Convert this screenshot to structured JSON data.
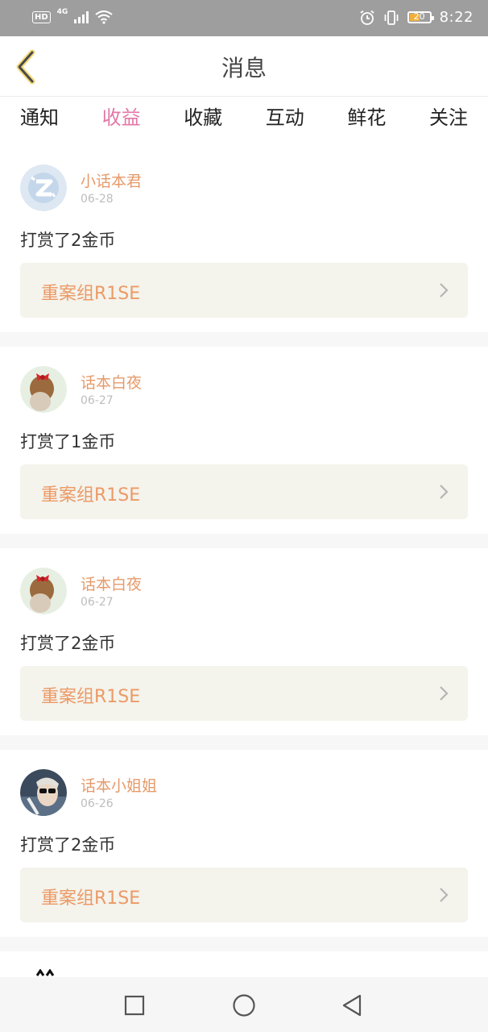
{
  "status_bar": {
    "hd": "HD",
    "network": "4G",
    "battery": "20",
    "time": "8:22"
  },
  "header": {
    "title": "消息"
  },
  "tabs": [
    {
      "label": "通知",
      "active": false
    },
    {
      "label": "收益",
      "active": true
    },
    {
      "label": "收藏",
      "active": false
    },
    {
      "label": "互动",
      "active": false
    },
    {
      "label": "鲜花",
      "active": false
    },
    {
      "label": "关注",
      "active": false
    }
  ],
  "feed": [
    {
      "user": "小话本君",
      "date": "06-28",
      "message": "打赏了2金币",
      "book": "重案组R1SE",
      "avatar": "logo-avatar"
    },
    {
      "user": "话本白夜",
      "date": "06-27",
      "message": "打赏了1金币",
      "book": "重案组R1SE",
      "avatar": "bow-avatar"
    },
    {
      "user": "话本白夜",
      "date": "06-27",
      "message": "打赏了2金币",
      "book": "重案组R1SE",
      "avatar": "bow-avatar"
    },
    {
      "user": "话本小姐姐",
      "date": "06-26",
      "message": "打赏了2金币",
      "book": "重案组R1SE",
      "avatar": "sunglasses-avatar"
    }
  ],
  "colors": {
    "accent": "#e278a7",
    "name_orange": "#e69a6a",
    "book_bg": "#f4f3ec"
  }
}
